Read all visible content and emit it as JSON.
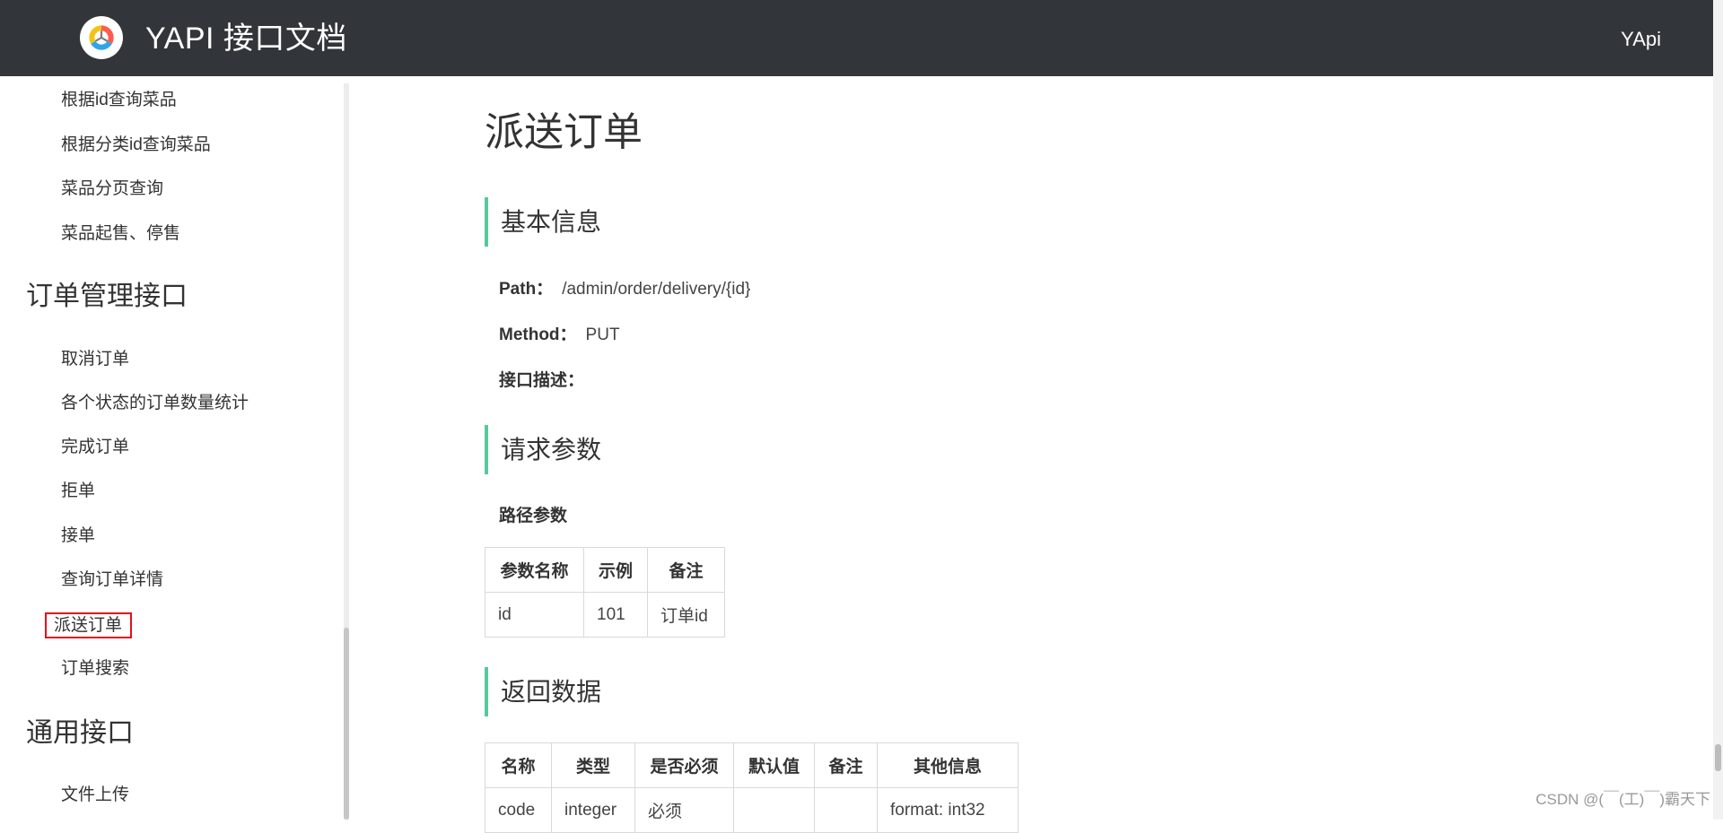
{
  "header": {
    "title": "YAPI 接口文档",
    "right_label": "YApi",
    "logo_icon": "yapi-logo-icon",
    "bg_color": "#32363a"
  },
  "sidebar": {
    "items_top": [
      "根据id查询菜品",
      "根据分类id查询菜品",
      "菜品分页查询",
      "菜品起售、停售"
    ],
    "group_order": "订单管理接口",
    "order_items": [
      "取消订单",
      "各个状态的订单数量统计",
      "完成订单",
      "拒单",
      "接单",
      "查询订单详情",
      "派送订单",
      "订单搜索"
    ],
    "active_item": "派送订单",
    "group_common": "通用接口",
    "common_items": [
      "文件上传"
    ]
  },
  "main": {
    "title": "派送订单",
    "basic_info": {
      "heading": "基本信息",
      "path_label": "Path：",
      "path_value": "/admin/order/delivery/{id}",
      "method_label": "Method：",
      "method_value": "PUT",
      "desc_label": "接口描述："
    },
    "request_params": {
      "heading": "请求参数",
      "path_params_label": "路径参数",
      "columns": [
        "参数名称",
        "示例",
        "备注"
      ],
      "rows": [
        [
          "id",
          "101",
          "订单id"
        ]
      ]
    },
    "response": {
      "heading": "返回数据",
      "columns": [
        "名称",
        "类型",
        "是否必须",
        "默认值",
        "备注",
        "其他信息"
      ],
      "rows": [
        [
          "code",
          "integer",
          "必须",
          "",
          "",
          "format: int32"
        ]
      ]
    },
    "accent_color": "#57c99b"
  },
  "watermark": "CSDN @(￣(工)￣)霸天下"
}
